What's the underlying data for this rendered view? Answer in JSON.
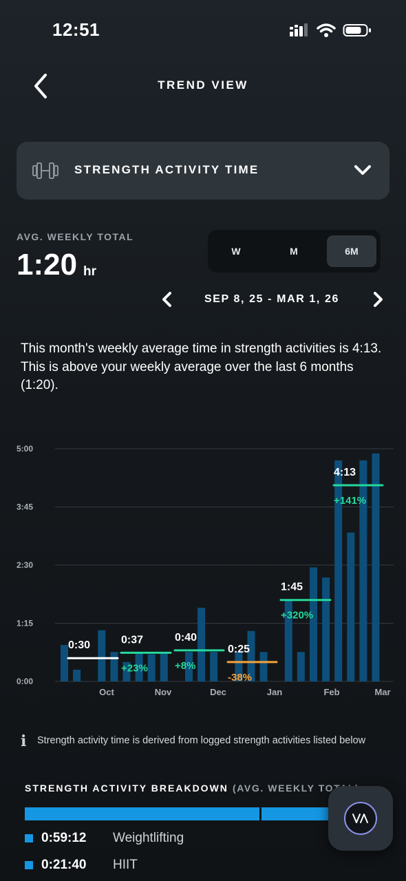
{
  "status_bar": {
    "time": "12:51"
  },
  "header": {
    "title": "TREND VIEW"
  },
  "metric_selector": {
    "label": "STRENGTH ACTIVITY TIME",
    "icon": "dumbbell-icon"
  },
  "summary": {
    "label": "AVG. WEEKLY TOTAL",
    "value": "1:20",
    "unit": "hr"
  },
  "range_tabs": [
    {
      "label": "W",
      "active": false
    },
    {
      "label": "M",
      "active": false
    },
    {
      "label": "6M",
      "active": true
    }
  ],
  "date_range": "SEP 8, 25 - MAR 1, 26",
  "insight_text": "This month's weekly average time in strength activities is 4:13. This is above your weekly average over the last 6 months (1:20).",
  "chart_data": {
    "type": "bar",
    "y_tick_labels": [
      "5:00",
      "3:45",
      "2:30",
      "1:15",
      "0:00"
    ],
    "y_ticks_minutes": [
      300,
      225,
      150,
      75,
      0
    ],
    "ylim_minutes": [
      0,
      300
    ],
    "x_tick_labels": [
      "Oct",
      "Nov",
      "Dec",
      "Jan",
      "Feb",
      "Mar"
    ],
    "weekly_values_minutes": [
      47,
      15,
      0,
      66,
      38,
      25,
      38,
      35,
      38,
      0,
      38,
      95,
      38,
      0,
      38,
      65,
      38,
      0,
      105,
      38,
      147,
      134,
      285,
      192,
      285,
      294
    ],
    "monthly_averages": [
      {
        "value_label": "0:30",
        "minutes": 30,
        "change": "",
        "color": "#ffffff"
      },
      {
        "value_label": "0:37",
        "minutes": 37,
        "change": "+23%",
        "color": "#25d99c"
      },
      {
        "value_label": "0:40",
        "minutes": 40,
        "change": "+8%",
        "color": "#25d99c"
      },
      {
        "value_label": "0:25",
        "minutes": 25,
        "change": "-38%",
        "color": "#f5a33a"
      },
      {
        "value_label": "1:45",
        "minutes": 105,
        "change": "+320%",
        "color": "#25d99c"
      },
      {
        "value_label": "4:13",
        "minutes": 253,
        "change": "+141%",
        "color": "#25d99c"
      }
    ],
    "bar_color": "#0d4f7a",
    "grid": true
  },
  "note": "Strength activity time is derived from logged strength activities listed below",
  "breakdown": {
    "title": "STRENGTH ACTIVITY BREAKDOWN",
    "subtitle": "(AVG. WEEKLY TOTAL)",
    "items": [
      {
        "value": "0:59:12",
        "name": "Weightlifting",
        "share": 0.73
      },
      {
        "value": "0:21:40",
        "name": "HIIT",
        "share": 0.27
      }
    ],
    "color": "#1597e4"
  },
  "fab": {
    "icon": "whoop-logo-icon"
  }
}
